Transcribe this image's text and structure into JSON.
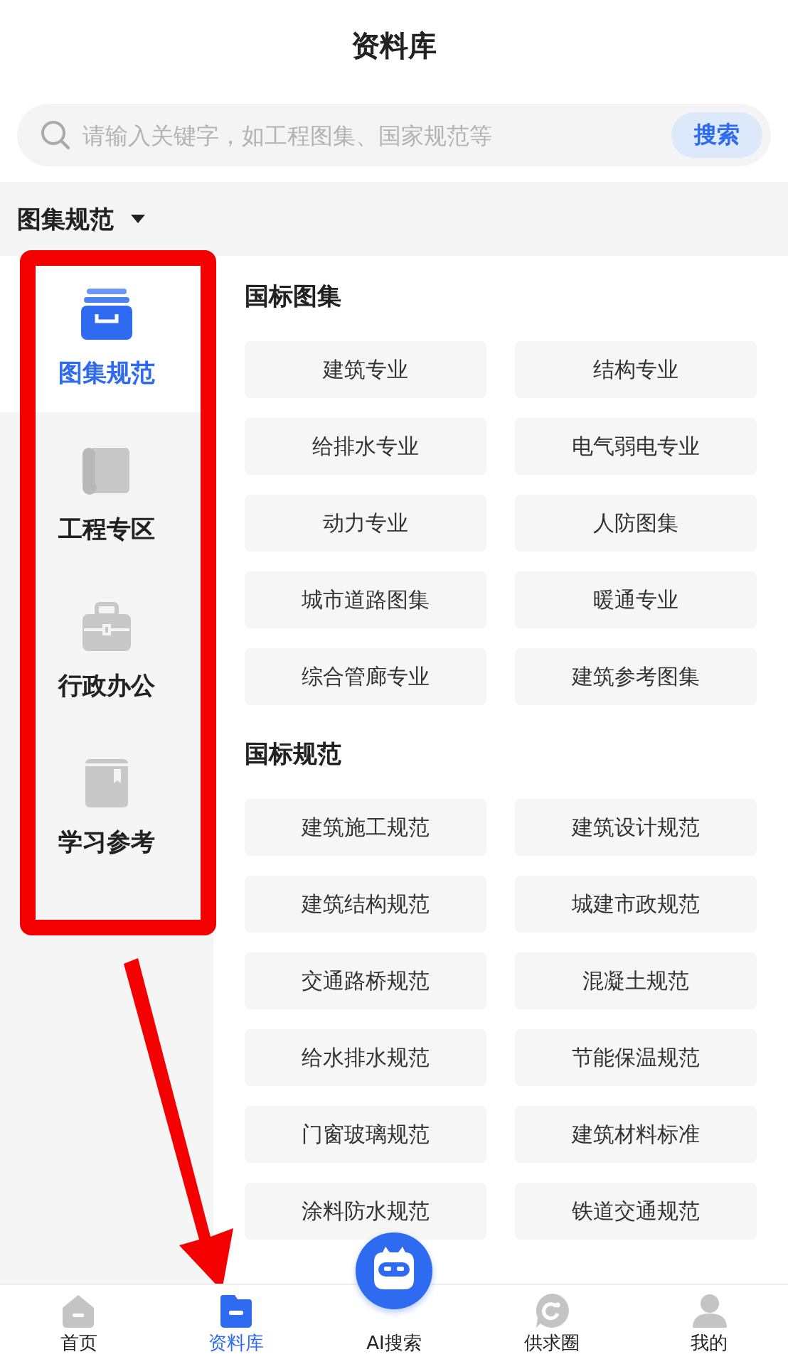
{
  "header": {
    "title": "资料库"
  },
  "search": {
    "placeholder": "请输入关键字，如工程图集、国家规范等",
    "button": "搜索"
  },
  "category": {
    "label": "图集规范"
  },
  "sidebar": {
    "items": [
      {
        "label": "图集规范",
        "selected": true
      },
      {
        "label": "工程专区",
        "selected": false
      },
      {
        "label": "行政办公",
        "selected": false
      },
      {
        "label": "学习参考",
        "selected": false
      }
    ]
  },
  "sections": [
    {
      "title": "国标图集",
      "items": [
        "建筑专业",
        "结构专业",
        "给排水专业",
        "电气弱电专业",
        "动力专业",
        "人防图集",
        "城市道路图集",
        "暖通专业",
        "综合管廊专业",
        "建筑参考图集"
      ]
    },
    {
      "title": "国标规范",
      "items": [
        "建筑施工规范",
        "建筑设计规范",
        "建筑结构规范",
        "城建市政规范",
        "交通路桥规范",
        "混凝土规范",
        "给水排水规范",
        "节能保温规范",
        "门窗玻璃规范",
        "建筑材料标准",
        "涂料防水规范",
        "铁道交通规范"
      ]
    }
  ],
  "tab_bar": {
    "items": [
      {
        "label": "首页",
        "kind": "tab",
        "selected": false
      },
      {
        "label": "资料库",
        "kind": "tab",
        "selected": true
      },
      {
        "label": "AI搜索",
        "kind": "raised",
        "selected": false
      },
      {
        "label": "供求圈",
        "kind": "tab",
        "selected": false
      },
      {
        "label": "我的",
        "kind": "tab",
        "selected": false
      }
    ]
  }
}
